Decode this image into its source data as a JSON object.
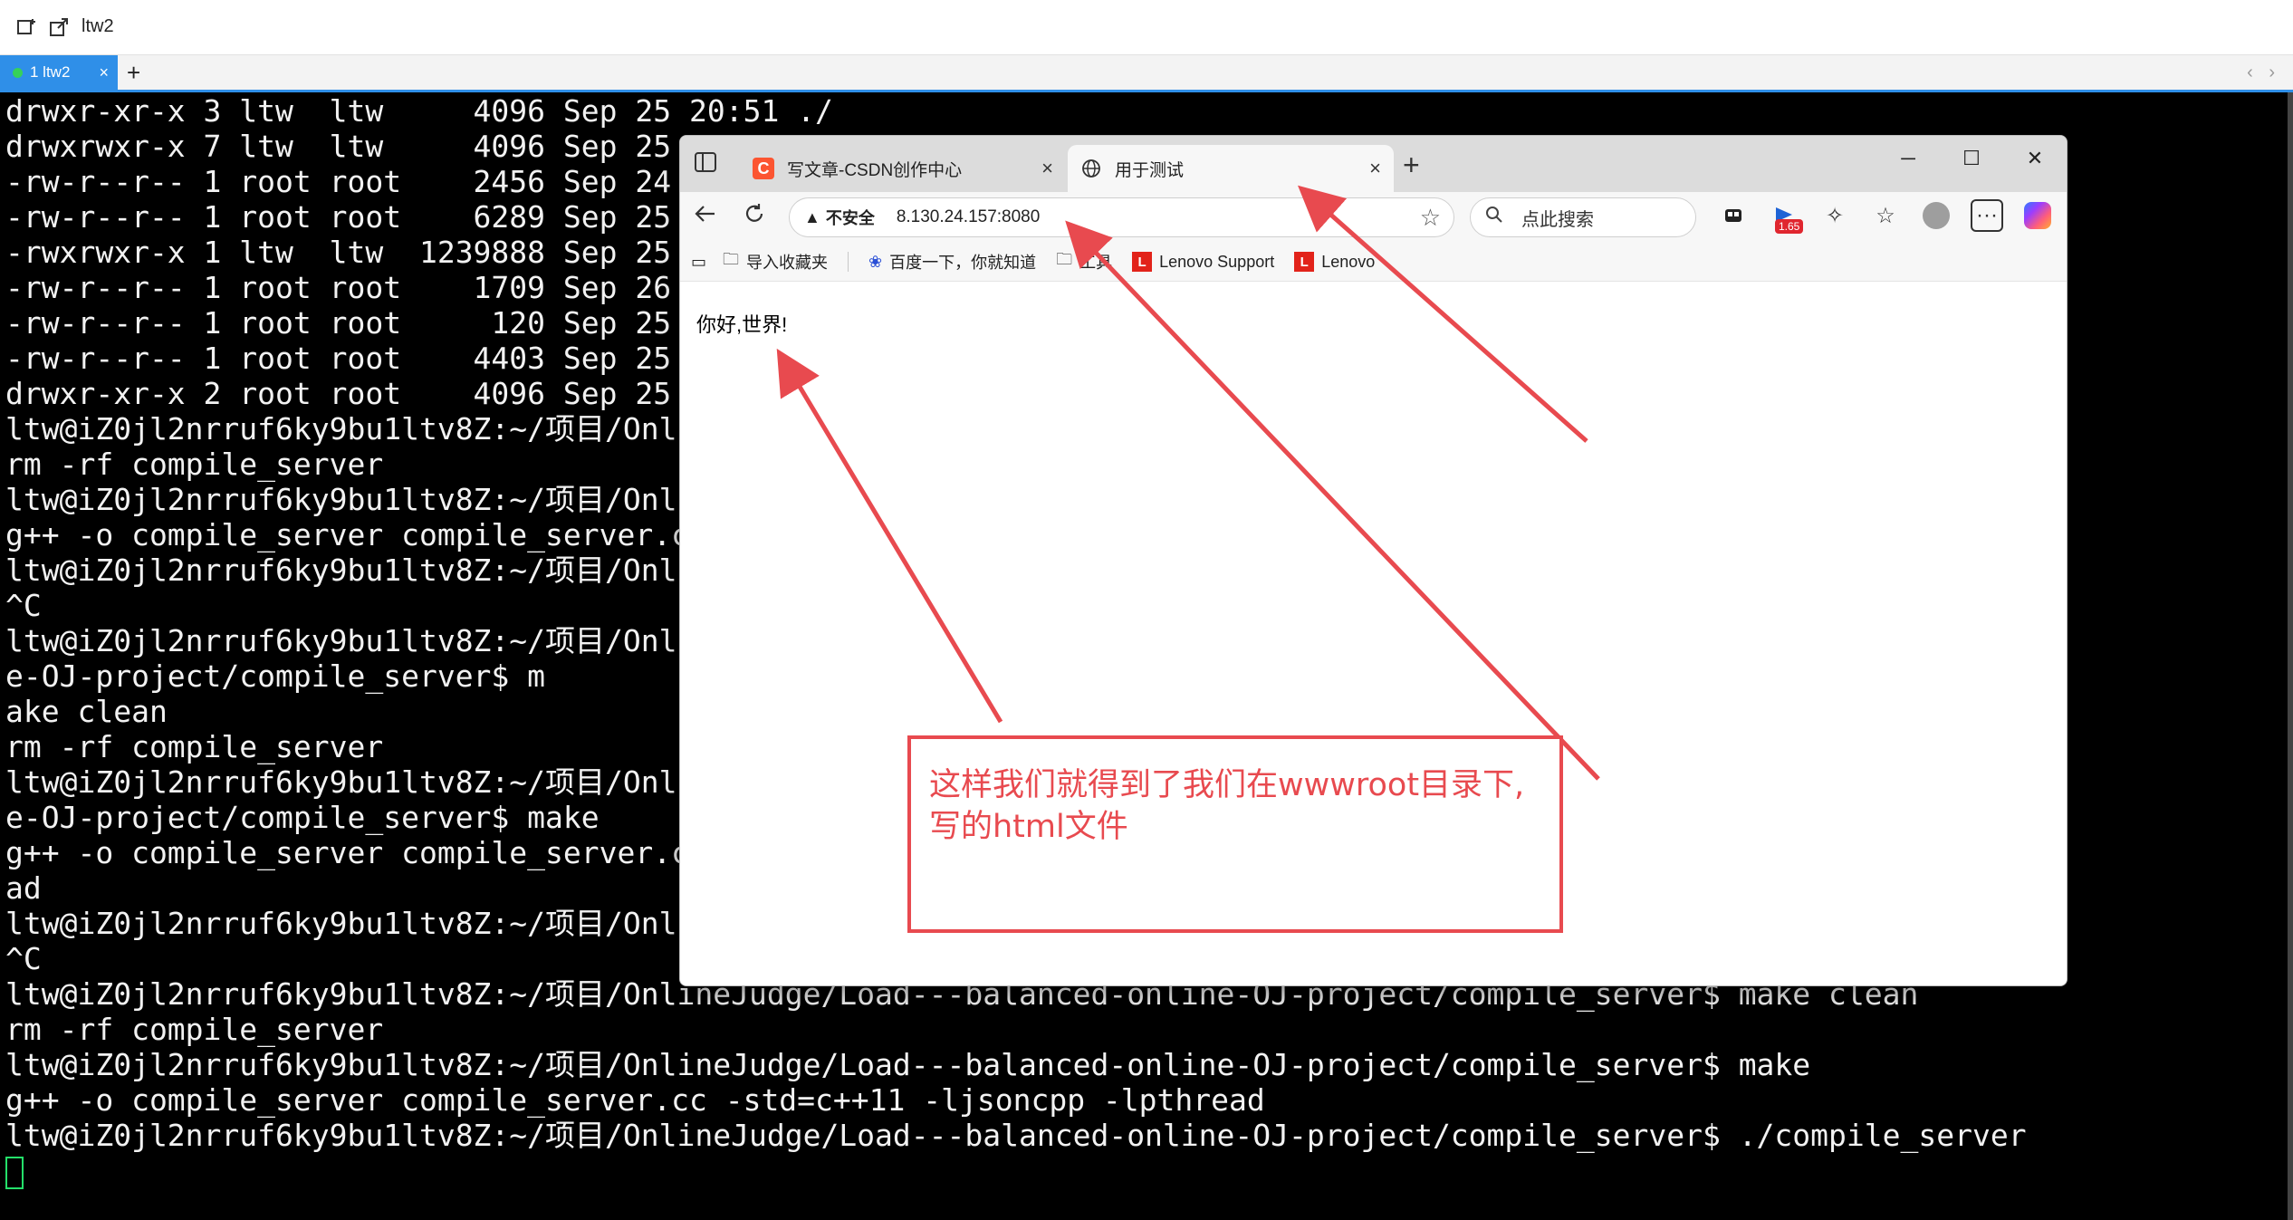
{
  "app": {
    "window_title": "ltw2",
    "tab_label": "1 ltw2",
    "tab_close": "×",
    "add_tab": "+",
    "scroll_arrows": "‹ ›"
  },
  "terminal": {
    "lines": [
      "drwxr-xr-x 3 ltw  ltw     4096 Sep 25 20:51 ./",
      "drwxrwxr-x 7 ltw  ltw     4096 Sep 25 1",
      "-rw-r--r-- 1 root root    2456 Sep 24 1",
      "-rw-r--r-- 1 root root    6289 Sep 25 1",
      "-rwxrwxr-x 1 ltw  ltw  1239888 Sep 25 2",
      "-rw-r--r-- 1 root root    1709 Sep 26 1",
      "-rw-r--r-- 1 root root     120 Sep 25 2",
      "-rw-r--r-- 1 root root    4403 Sep 25 0",
      "drwxr-xr-x 2 root root    4096 Sep 25 1",
      "ltw@iZ0jl2nrruf6ky9bu1ltv8Z:~/项目/Onli",
      "rm -rf compile_server",
      "ltw@iZ0jl2nrruf6ky9bu1ltv8Z:~/项目/Onli",
      "g++ -o compile_server compile_server.cc",
      "ltw@iZ0jl2nrruf6ky9bu1ltv8Z:~/项目/Onli",
      "^C",
      "ltw@iZ0jl2nrruf6ky9bu1ltv8Z:~/项目/Onli",
      "e-OJ-project/compile_server$ m",
      "ake clean",
      "rm -rf compile_server",
      "ltw@iZ0jl2nrruf6ky9bu1ltv8Z:~/项目/Onli",
      "e-OJ-project/compile_server$ make",
      "g++ -o compile_server compile_server.cc",
      "ad",
      "ltw@iZ0jl2nrruf6ky9bu1ltv8Z:~/项目/Onli",
      "^C",
      "ltw@iZ0jl2nrruf6ky9bu1ltv8Z:~/项目/OnlineJudge/Load---balanced-online-OJ-project/compile_server$ make clean",
      "rm -rf compile_server",
      "ltw@iZ0jl2nrruf6ky9bu1ltv8Z:~/项目/OnlineJudge/Load---balanced-online-OJ-project/compile_server$ make",
      "g++ -o compile_server compile_server.cc -std=c++11 -ljsoncpp -lpthread",
      "ltw@iZ0jl2nrruf6ky9bu1ltv8Z:~/项目/OnlineJudge/Load---balanced-online-OJ-project/compile_server$ ./compile_server"
    ]
  },
  "browser": {
    "tabs": [
      {
        "title": "写文章-CSDN创作中心",
        "favicon": "C",
        "close": "×"
      },
      {
        "title": "用于测试",
        "favicon": "globe-icon",
        "close": "×"
      }
    ],
    "new_tab": "+",
    "window_controls": {
      "minimize": "─",
      "maximize": "☐",
      "close": "✕"
    },
    "address": {
      "security_label": "不安全",
      "url": "8.130.24.157:8080"
    },
    "search_placeholder": "点此搜索",
    "extension_badge": "1.65",
    "more_label": "···",
    "bookmarks": [
      {
        "label": "导入收藏夹",
        "icon": "folder-icon"
      },
      {
        "label": "百度一下，你就知道",
        "icon": "baidu-paw-icon"
      },
      {
        "label": "工具",
        "icon": "folder-icon"
      },
      {
        "label": "Lenovo Support",
        "icon": "lenovo-icon"
      },
      {
        "label": "Lenovo",
        "icon": "lenovo-icon"
      }
    ],
    "lenovo_letter": "L",
    "page_text": "你好,世界!"
  },
  "annotation": {
    "text": "这样我们就得到了我们在wwwroot目录下,写的html文件",
    "color": "#e84a4f"
  },
  "colors": {
    "terminal_bg": "#000000",
    "terminal_fg": "#f2f2f2",
    "tab_accent": "#2f8fe8",
    "cursor": "#24e06a"
  }
}
